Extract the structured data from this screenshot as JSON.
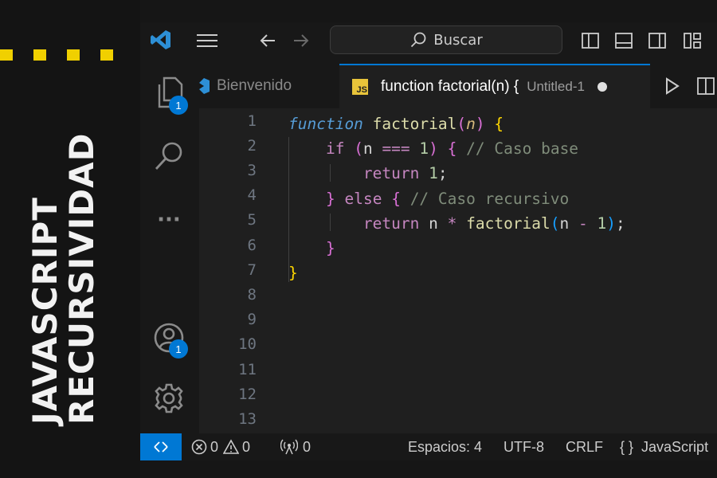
{
  "banner": {
    "line1": "JAVASCRIPT",
    "line2": "RECURSIVIDAD",
    "accent_color": "#f0d000"
  },
  "titlebar": {
    "search_label": "Buscar",
    "icons": [
      "vscode-logo-icon",
      "menu-icon",
      "back-arrow-icon",
      "forward-arrow-icon",
      "search-icon",
      "toggle-sidebar-icon",
      "toggle-panel-icon",
      "toggle-secondary-sidebar-icon",
      "customize-layout-icon"
    ]
  },
  "activity": {
    "explorer_badge": "1",
    "accounts_badge": "1",
    "more_label": "···"
  },
  "tabs": [
    {
      "label": "Bienvenido",
      "icon": "vscode-logo-icon",
      "active": false
    },
    {
      "label": "function factorial(n) {",
      "detail": "Untitled-1",
      "icon_label": "JS",
      "active": true,
      "dirty": true
    }
  ],
  "editor": {
    "line_numbers": [
      "1",
      "2",
      "3",
      "4",
      "5",
      "6",
      "7",
      "8",
      "9",
      "10",
      "11",
      "12",
      "13"
    ],
    "language": "javascript"
  },
  "status": {
    "errors": "0",
    "warnings": "0",
    "ports": "0",
    "spaces": "Espacios: 4",
    "encoding": "UTF-8",
    "eol": "CRLF",
    "language_brackets": "{ }",
    "language": "JavaScript"
  },
  "colors": {
    "keyword_italic": "#569cd6",
    "function_name": "#dcdcaa",
    "param": "#d7ba7d",
    "control": "#c586c0",
    "comment": "#7f8c7a",
    "number": "#b5cea8",
    "bracket1": "#ffd700",
    "bracket2": "#da70d6",
    "bracket3": "#179fff",
    "accent": "#0078d4"
  }
}
